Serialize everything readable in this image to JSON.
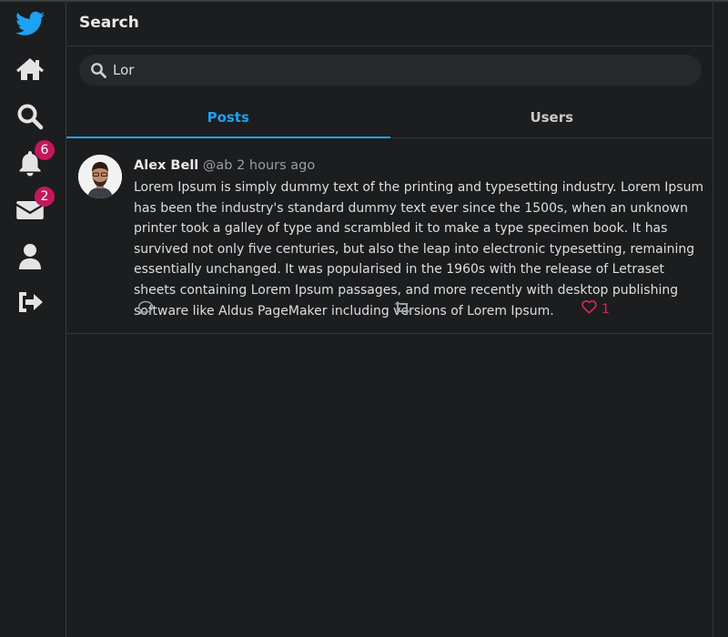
{
  "sidebar": {
    "items": [
      {
        "icon": "twitter-bird-icon"
      },
      {
        "icon": "home-icon"
      },
      {
        "icon": "search-icon"
      },
      {
        "icon": "bell-icon",
        "badge": "6"
      },
      {
        "icon": "envelope-icon",
        "badge": "2"
      },
      {
        "icon": "user-icon"
      },
      {
        "icon": "sign-out-icon"
      }
    ]
  },
  "header": {
    "title": "Search"
  },
  "search": {
    "value": "Lor",
    "placeholder": ""
  },
  "tabs": [
    {
      "label": "Posts",
      "active": true
    },
    {
      "label": "Users",
      "active": false
    }
  ],
  "post": {
    "author": "Alex Bell",
    "handle": "@ab",
    "time": "2 hours ago",
    "text": "Lorem Ipsum is simply dummy text of the printing and typesetting industry. Lorem Ipsum has been the industry's standard dummy text ever since the 1500s, when an unknown printer took a galley of type and scrambled it to make a type specimen book. It has survived not only five centuries, but also the leap into electronic typesetting, remaining essentially unchanged. It was popularised in the 1960s with the release of Letraset sheets containing Lorem Ipsum passages, and more recently with desktop publishing software like Aldus PageMaker including versions of Lorem Ipsum.",
    "likes": "1"
  },
  "colors": {
    "accent": "#1da1f2",
    "badge": "#c2185b",
    "like": "#e0245e",
    "background": "#1b1d1f"
  }
}
